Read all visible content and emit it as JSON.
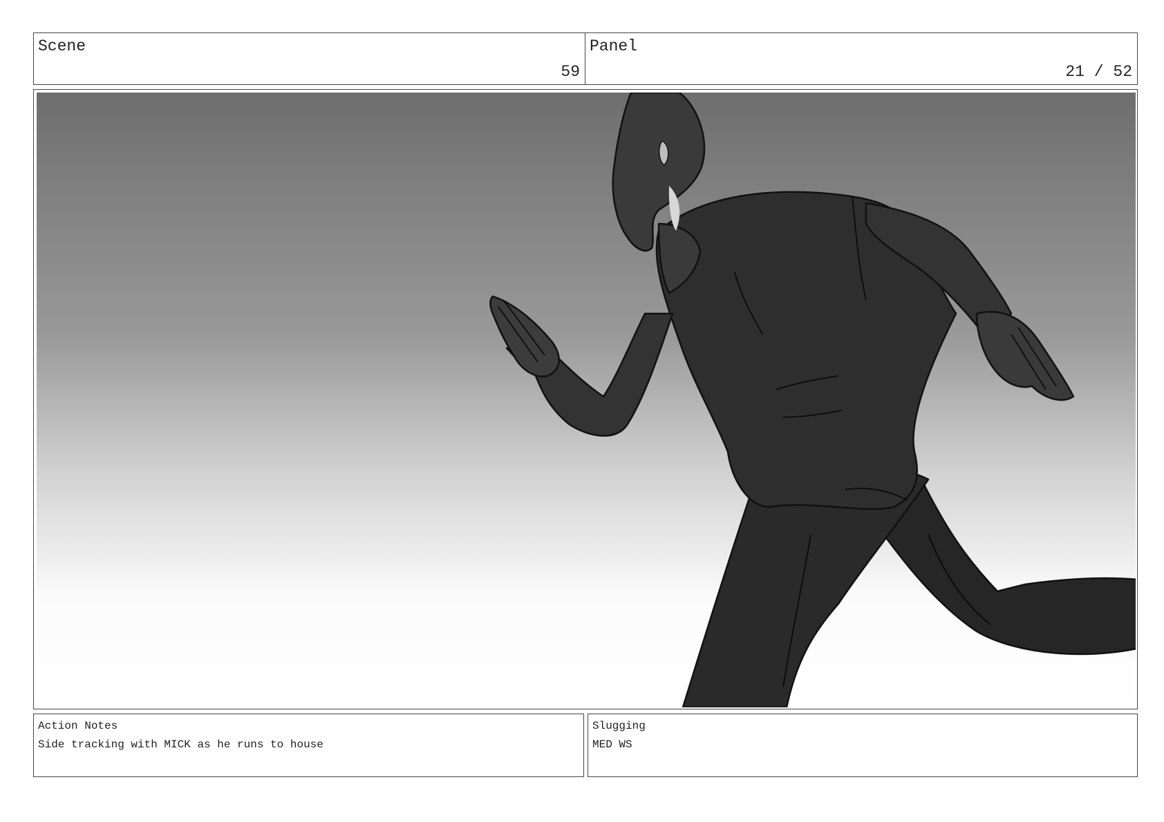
{
  "scene": {
    "label": "Scene",
    "value": "59"
  },
  "panel": {
    "label": "Panel",
    "value": "21 / 52"
  },
  "frame": {
    "subject": "running-figure",
    "background_gradient": [
      "#6e6e6e",
      "#9a9a9a",
      "#d4d4d4",
      "#ffffff"
    ]
  },
  "action_notes": {
    "label": "Action Notes",
    "text": "Side tracking with MICK as he runs to house"
  },
  "slugging": {
    "label": "Slugging",
    "text": "MED WS"
  }
}
